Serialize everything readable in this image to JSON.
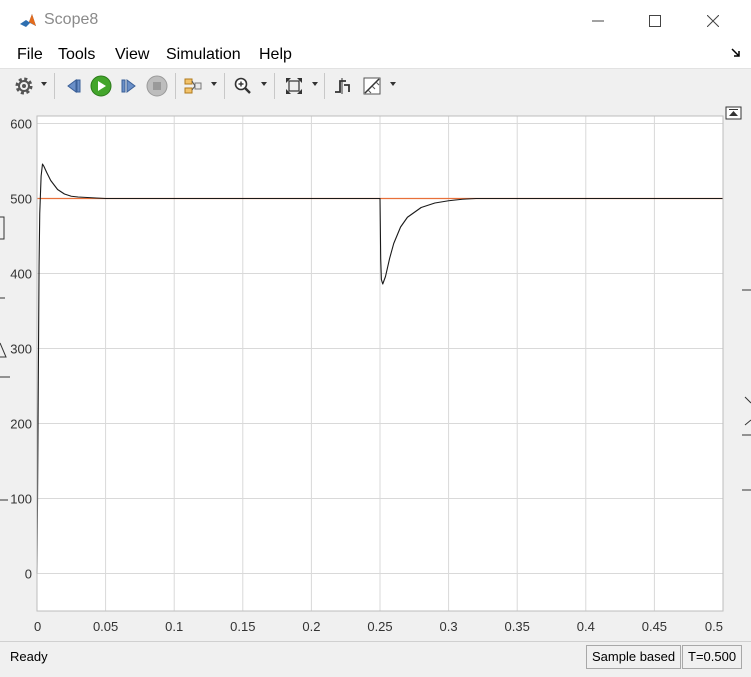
{
  "window": {
    "title": "Scope8",
    "controls": [
      "minimize",
      "maximize",
      "close"
    ]
  },
  "menu": {
    "items": [
      "File",
      "Tools",
      "View",
      "Simulation",
      "Help"
    ]
  },
  "toolbar": {
    "buttons": [
      {
        "icon": "gear-icon",
        "dropdown": true
      },
      {
        "icon": "step-back-icon",
        "dropdown": false
      },
      {
        "icon": "run-icon",
        "dropdown": false
      },
      {
        "icon": "step-forward-icon",
        "dropdown": false
      },
      {
        "icon": "stop-icon",
        "dropdown": false
      },
      {
        "icon": "signal-selector-icon",
        "dropdown": true
      },
      {
        "icon": "zoom-in-icon",
        "dropdown": true
      },
      {
        "icon": "fit-to-view-icon",
        "dropdown": true
      },
      {
        "icon": "triggers-icon",
        "dropdown": false
      },
      {
        "icon": "cursor-measurements-icon",
        "dropdown": true
      }
    ]
  },
  "status": {
    "left": "Ready",
    "mode": "Sample based",
    "time": "T=0.500"
  },
  "chart_data": {
    "type": "line",
    "xlim": [
      0,
      0.5
    ],
    "ylim": [
      -50,
      610
    ],
    "xticks": [
      "0",
      "0.05",
      "0.1",
      "0.15",
      "0.2",
      "0.25",
      "0.3",
      "0.35",
      "0.4",
      "0.45",
      "0.5"
    ],
    "yticks": [
      "0",
      "100",
      "200",
      "300",
      "400",
      "500",
      "600"
    ],
    "grid": true,
    "series": [
      {
        "color": "#e8703a",
        "x": [
          0,
          0.5
        ],
        "y": [
          500,
          500
        ]
      },
      {
        "color": "#1a1a1a",
        "x": [
          0,
          0.0005,
          0.001,
          0.0015,
          0.002,
          0.003,
          0.004,
          0.005,
          0.007,
          0.01,
          0.015,
          0.02,
          0.025,
          0.03,
          0.04,
          0.05,
          0.07,
          0.1,
          0.15,
          0.2,
          0.25,
          0.2502,
          0.2505,
          0.251,
          0.252,
          0.254,
          0.257,
          0.26,
          0.265,
          0.27,
          0.28,
          0.29,
          0.3,
          0.31,
          0.32,
          0.35,
          0.4,
          0.45,
          0.5
        ],
        "y": [
          0,
          130,
          270,
          410,
          480,
          530,
          546,
          543,
          535,
          524,
          512,
          506,
          503,
          502,
          501,
          500,
          500,
          500,
          500,
          500,
          500,
          470,
          420,
          392,
          386,
          396,
          420,
          440,
          462,
          475,
          488,
          494,
          497,
          499,
          500,
          500,
          500,
          500,
          500
        ]
      }
    ]
  }
}
